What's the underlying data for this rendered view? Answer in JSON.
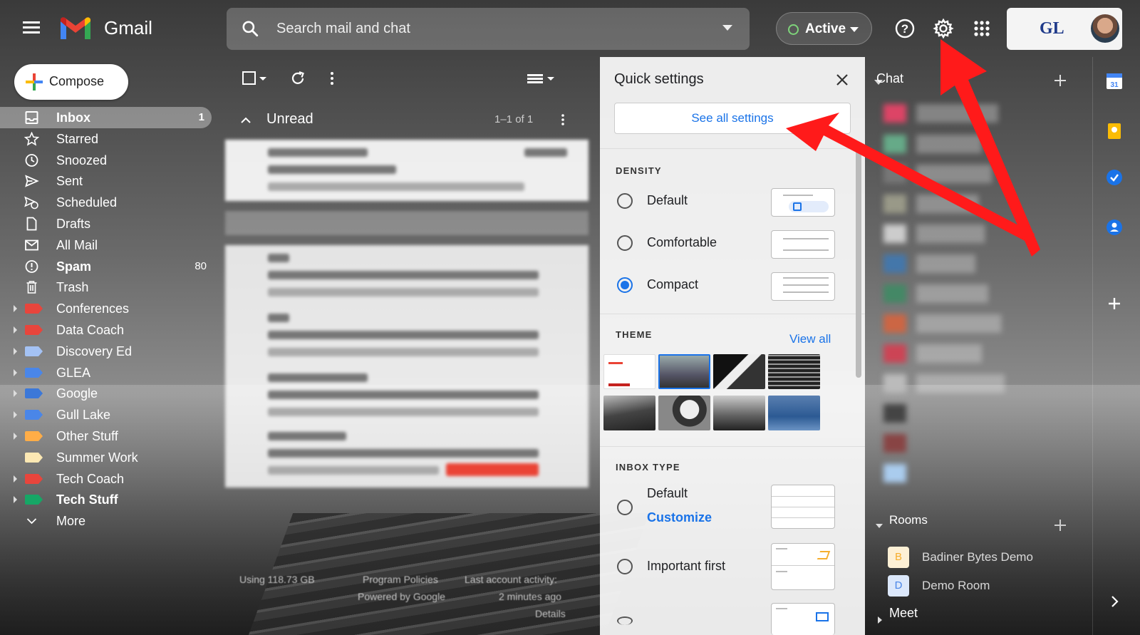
{
  "app": {
    "name": "Gmail"
  },
  "search": {
    "placeholder": "Search mail and chat"
  },
  "status": {
    "label": "Active",
    "color": "#7ed37a"
  },
  "header_icons": [
    "help-icon",
    "gear-icon",
    "apps-grid-icon"
  ],
  "account": {
    "org_logo": "GL"
  },
  "compose": {
    "label": "Compose"
  },
  "nav": {
    "items": [
      {
        "label": "Inbox",
        "count": "1",
        "icon": "inbox-icon",
        "bold": true
      },
      {
        "label": "Starred",
        "icon": "star-icon"
      },
      {
        "label": "Snoozed",
        "icon": "clock-icon"
      },
      {
        "label": "Sent",
        "icon": "send-icon"
      },
      {
        "label": "Scheduled",
        "icon": "scheduled-icon"
      },
      {
        "label": "Drafts",
        "icon": "draft-icon"
      },
      {
        "label": "All Mail",
        "icon": "mail-icon"
      },
      {
        "label": "Spam",
        "count": "80",
        "icon": "spam-icon",
        "bold": true
      },
      {
        "label": "Trash",
        "icon": "trash-icon"
      }
    ],
    "labels": [
      {
        "label": "Conferences",
        "color": "#e8453c"
      },
      {
        "label": "Data Coach",
        "color": "#e8453c"
      },
      {
        "label": "Discovery Ed",
        "color": "#a4c2f4"
      },
      {
        "label": "GLEA",
        "color": "#4a86e8"
      },
      {
        "label": "Google",
        "color": "#3c78d8"
      },
      {
        "label": "Gull Lake",
        "color": "#4a86e8"
      },
      {
        "label": "Other Stuff",
        "color": "#ffad47"
      },
      {
        "label": "Summer Work",
        "color": "#fce8b3"
      },
      {
        "label": "Tech Coach",
        "color": "#e8453c"
      },
      {
        "label": "Tech Stuff",
        "color": "#16a766",
        "bold": true
      }
    ],
    "more": "More"
  },
  "mail_list": {
    "section": "Unread",
    "range": "1–1 of 1"
  },
  "footer": {
    "storage": "Using 118.73 GB",
    "policies": "Program Policies",
    "powered": "Powered by Google",
    "activity": "Last account activity:",
    "activity_time": "2 minutes ago",
    "details": "Details"
  },
  "quick_settings": {
    "title": "Quick settings",
    "see_all": "See all settings",
    "density": {
      "heading": "DENSITY",
      "options": [
        "Default",
        "Comfortable",
        "Compact"
      ],
      "selected": "Compact"
    },
    "theme": {
      "heading": "THEME",
      "view_all": "View all"
    },
    "inbox_type": {
      "heading": "INBOX TYPE",
      "default": "Default",
      "customize": "Customize",
      "important_first": "Important first"
    }
  },
  "chat": {
    "heading": "Chat",
    "rooms_heading": "Rooms",
    "rooms": [
      {
        "initial": "B",
        "name": "Badiner Bytes Demo",
        "color": "#f6ae2d"
      },
      {
        "initial": "D",
        "name": "Demo Room",
        "color": "#4a86e8"
      }
    ],
    "meet": "Meet"
  },
  "side_panel_icons": [
    "calendar-icon",
    "keep-icon",
    "tasks-icon",
    "contacts-icon",
    "add-icon"
  ],
  "annotation_color": "#ff1a1a"
}
